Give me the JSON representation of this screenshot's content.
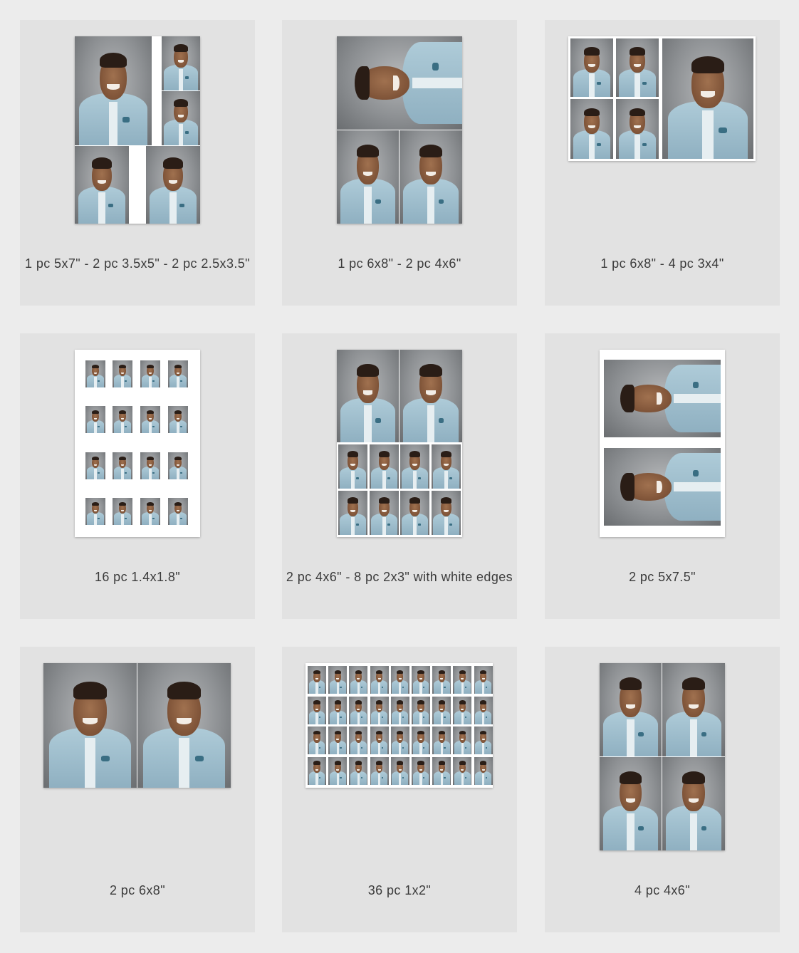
{
  "layouts": [
    {
      "label": "1 pc 5x7\" - 2 pc 3.5x5\" - 2 pc 2.5x3.5\""
    },
    {
      "label": "1 pc 6x8\" - 2 pc 4x6\""
    },
    {
      "label": "1 pc 6x8\" - 4 pc 3x4\""
    },
    {
      "label": "16 pc 1.4x1.8\""
    },
    {
      "label": "2 pc 4x6\" - 8 pc 2x3\" with white edges"
    },
    {
      "label": "2 pc 5x7.5\""
    },
    {
      "label": "2 pc 6x8\""
    },
    {
      "label": "36 pc 1x2\""
    },
    {
      "label": "4 pc 4x6\""
    }
  ]
}
